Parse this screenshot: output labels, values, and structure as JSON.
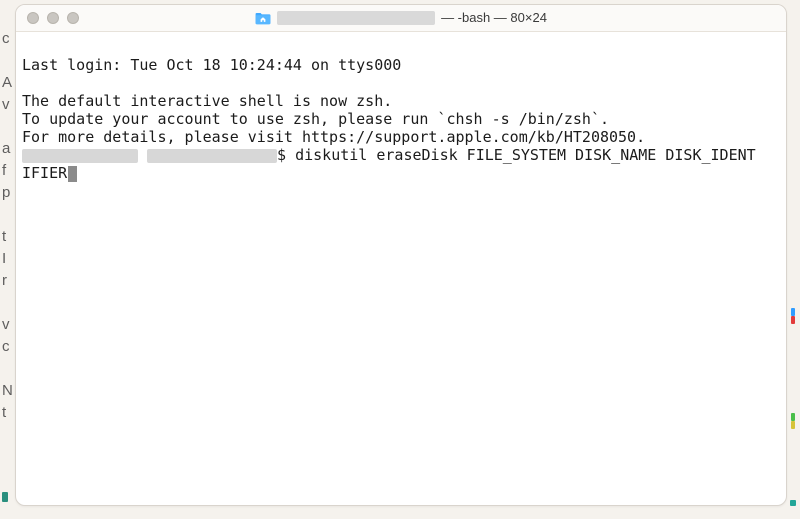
{
  "background_edge_letters": "c\n \nA\nv\n \na\nf\np\n \nt\nI\nr\n \nv\nc\n \nN\nt",
  "titlebar": {
    "folder_icon": "home-folder-icon",
    "title_suffix": "— -bash — 80×24"
  },
  "terminal": {
    "last_login": "Last login: Tue Oct 18 10:24:44 on ttys000",
    "blank": "",
    "zsh_notice_1": "The default interactive shell is now zsh.",
    "zsh_notice_2": "To update your account to use zsh, please run `chsh -s /bin/zsh`.",
    "zsh_notice_3": "For more details, please visit https://support.apple.com/kb/HT208050.",
    "prompt_sep": "$",
    "command_line_1": " diskutil eraseDisk FILE_SYSTEM DISK_NAME DISK_IDENT",
    "command_line_2": "IFIER"
  }
}
